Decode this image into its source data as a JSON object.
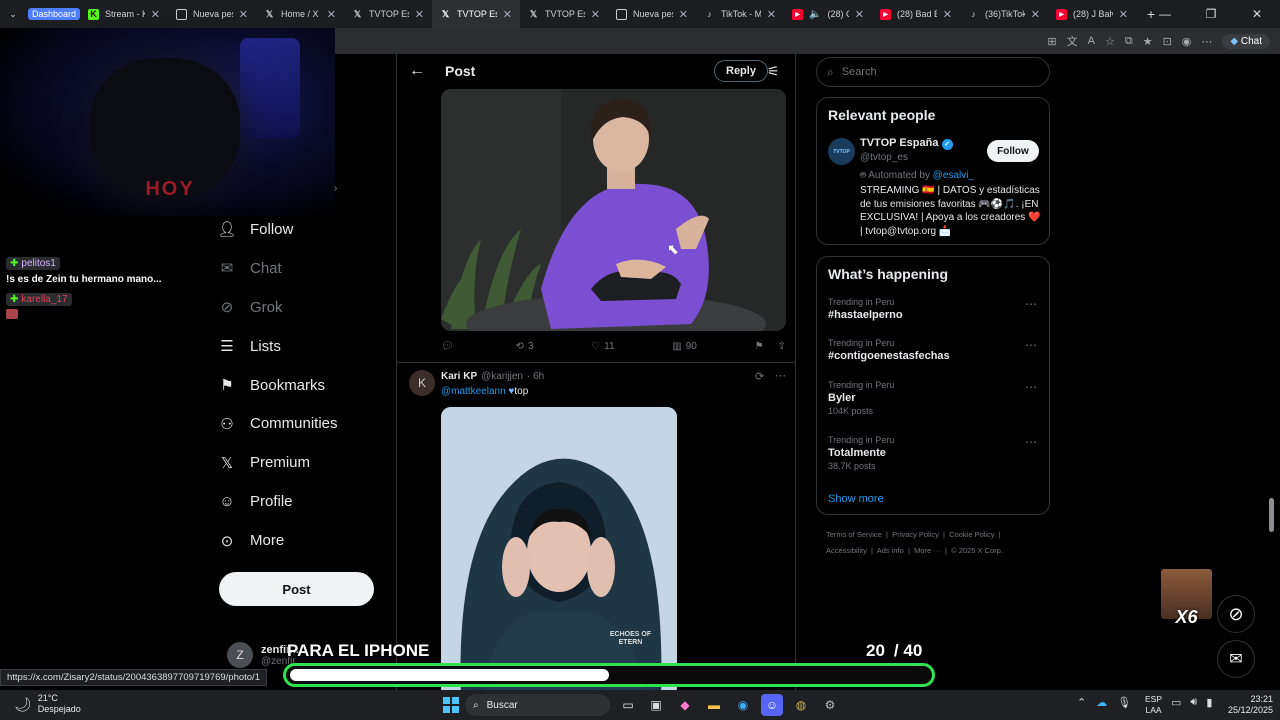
{
  "browser": {
    "tabs": [
      {
        "label": "",
        "type": "menu"
      },
      {
        "label": "Dashboard",
        "icon": "dashboard-badge",
        "color": "#4e7dff"
      },
      {
        "label": "Stream - Kick",
        "icon": "kick-icon",
        "color": "#53fc18"
      },
      {
        "label": "Nueva pestañ",
        "icon": "page-icon",
        "color": "#ffffff"
      },
      {
        "label": "Home / X",
        "icon": "x-icon",
        "color": "#ffffff"
      },
      {
        "label": "TVTOP Españ",
        "icon": "x-icon",
        "color": "#ffffff"
      },
      {
        "label": "TVTOP Españ",
        "icon": "x-icon",
        "color": "#ffffff",
        "active": true
      },
      {
        "label": "TVTOP Españ",
        "icon": "x-icon",
        "color": "#ffffff"
      },
      {
        "label": "Nueva pestañ",
        "icon": "page-icon",
        "color": "#ffffff"
      },
      {
        "label": "TikTok - Make",
        "icon": "tiktok-icon",
        "color": "#ffffff"
      },
      {
        "label": "(28) Chri",
        "icon": "youtube-icon",
        "color": "#ff0033"
      },
      {
        "label": "(28) Bad Bunn",
        "icon": "youtube-icon",
        "color": "#ff0033"
      },
      {
        "label": "(36)TikTok - M",
        "icon": "tiktok-icon",
        "color": "#ffffff"
      },
      {
        "label": "(28) J Balvin, J",
        "icon": "youtube-icon",
        "color": "#ff0033"
      }
    ],
    "chat_label": "Chat",
    "status_url": "https://x.com/Zisary2/status/2004363897709719769/photo/1"
  },
  "stream": {
    "shirt_text": "HOY",
    "chat": [
      {
        "user": "pelitos1",
        "message": "!s es de Zein tu hermano mano..."
      },
      {
        "user": "karella_17",
        "message": ""
      }
    ]
  },
  "nav": {
    "items": [
      {
        "label": "Follow",
        "icon": "follow-icon",
        "dim": false
      },
      {
        "label": "Chat",
        "icon": "mail-icon",
        "dim": true
      },
      {
        "label": "Grok",
        "icon": "grok-icon",
        "dim": true
      },
      {
        "label": "Lists",
        "icon": "lists-icon",
        "dim": false
      },
      {
        "label": "Bookmarks",
        "icon": "bookmark-icon",
        "dim": false
      },
      {
        "label": "Communities",
        "icon": "communities-icon",
        "dim": false
      },
      {
        "label": "Premium",
        "icon": "x-premium-icon",
        "dim": false
      },
      {
        "label": "Profile",
        "icon": "profile-icon",
        "dim": false
      },
      {
        "label": "More",
        "icon": "more-icon",
        "dim": false
      }
    ],
    "post_label": "Post",
    "account_name": "zenfir...",
    "account_handle": "@zenfir..."
  },
  "post": {
    "header_title": "Post",
    "reply_label": "Reply",
    "actions": {
      "replies": "",
      "reposts": "3",
      "likes": "11",
      "views": "90"
    },
    "reply": {
      "avatar_letter": "K",
      "name": "Kari KP",
      "handle": "@karijjen",
      "time": "· 6h",
      "mention": "@mattkeelann",
      "text": "top",
      "hoodie_text": "ECHOES OF ETERN"
    }
  },
  "sidebar": {
    "search_placeholder": "Search",
    "relevant": {
      "title": "Relevant people",
      "name": "TVTOP España",
      "handle": "@tvtop_es",
      "avatar_text": "TVTOP",
      "follow_label": "Follow",
      "automated_prefix": "Automated by",
      "automated_by": "@esalvi_",
      "bio": "STREAMING 🇪🇸 | DATOS y estadísticas de tus emisiones favoritas 🎮⚽🎵. ¡EN EXCLUSIVA! | Apoya a los creadores ❤️ | tvtop@tvtop.org 📩"
    },
    "happening": {
      "title": "What’s happening",
      "trends": [
        {
          "meta": "Trending in Peru",
          "name": "#hastaelperno",
          "count": ""
        },
        {
          "meta": "Trending in Peru",
          "name": "#contigoenestasfechas",
          "count": ""
        },
        {
          "meta": "Trending in Peru",
          "name": "Byler",
          "count": "104K posts"
        },
        {
          "meta": "Trending in Peru",
          "name": "Totalmente",
          "count": "38.7K posts"
        }
      ],
      "show_more": "Show more"
    },
    "footer": [
      "Terms of Service",
      "Privacy Policy",
      "Cookie Policy",
      "Accessibility",
      "Ads info",
      "More ···",
      "© 2025 X Corp."
    ]
  },
  "overlay": {
    "goal_text": "PARA EL IPHONE",
    "goal_current": "20",
    "goal_total": "/ 40",
    "progress": 0.5,
    "emote_label": "X6"
  },
  "taskbar": {
    "temp": "21°C",
    "weather": "Despejado",
    "search_label": "Buscar",
    "lang_top": "ESP",
    "lang_bottom": "LAA",
    "time": "23:21",
    "date": "25/12/2025"
  },
  "colors": {
    "accent": "#1d9bf0",
    "progress_border": "#2ee34e",
    "post_bg": "#eff3f4"
  }
}
